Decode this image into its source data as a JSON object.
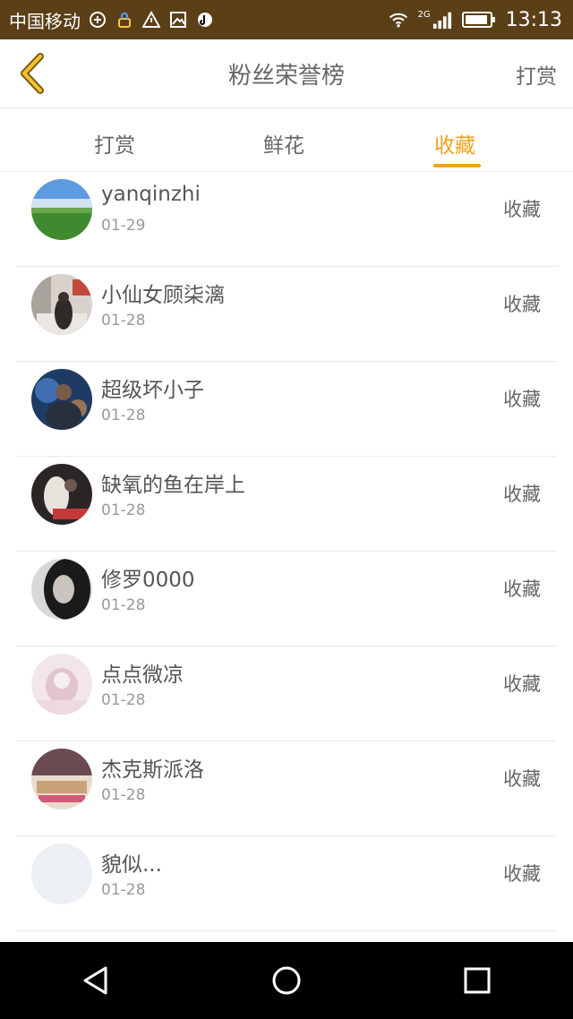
{
  "status_bar": {
    "carrier": "中国移动",
    "network": "2G",
    "time": "13:13",
    "icons": [
      "data-icon",
      "vpn-icon",
      "warning-icon",
      "image-icon",
      "tiktok-icon",
      "wifi-icon",
      "signal-icon",
      "battery-icon"
    ]
  },
  "header": {
    "title": "粉丝荣誉榜",
    "action_label": "打赏"
  },
  "tabs": [
    {
      "label": "打赏"
    },
    {
      "label": "鲜花"
    },
    {
      "label": "收藏",
      "active": true
    }
  ],
  "colors": {
    "accent": "#f2a11a",
    "status_bar": "#5a3f17"
  },
  "users": [
    {
      "name": "yanqinzhi",
      "date": "01-29",
      "action": "收藏"
    },
    {
      "name": "小仙女顾柒漓",
      "date": "01-28",
      "action": "收藏"
    },
    {
      "name": "超级坏小子",
      "date": "01-28",
      "action": "收藏"
    },
    {
      "name": "缺氧的鱼在岸上",
      "date": "01-28",
      "action": "收藏"
    },
    {
      "name": "修罗0000",
      "date": "01-28",
      "action": "收藏"
    },
    {
      "name": "点点微凉",
      "date": "01-28",
      "action": "收藏"
    },
    {
      "name": "杰克斯派洛",
      "date": "01-28",
      "action": "收藏"
    },
    {
      "name": "貌似...",
      "date": "01-28",
      "action": "收藏"
    }
  ]
}
